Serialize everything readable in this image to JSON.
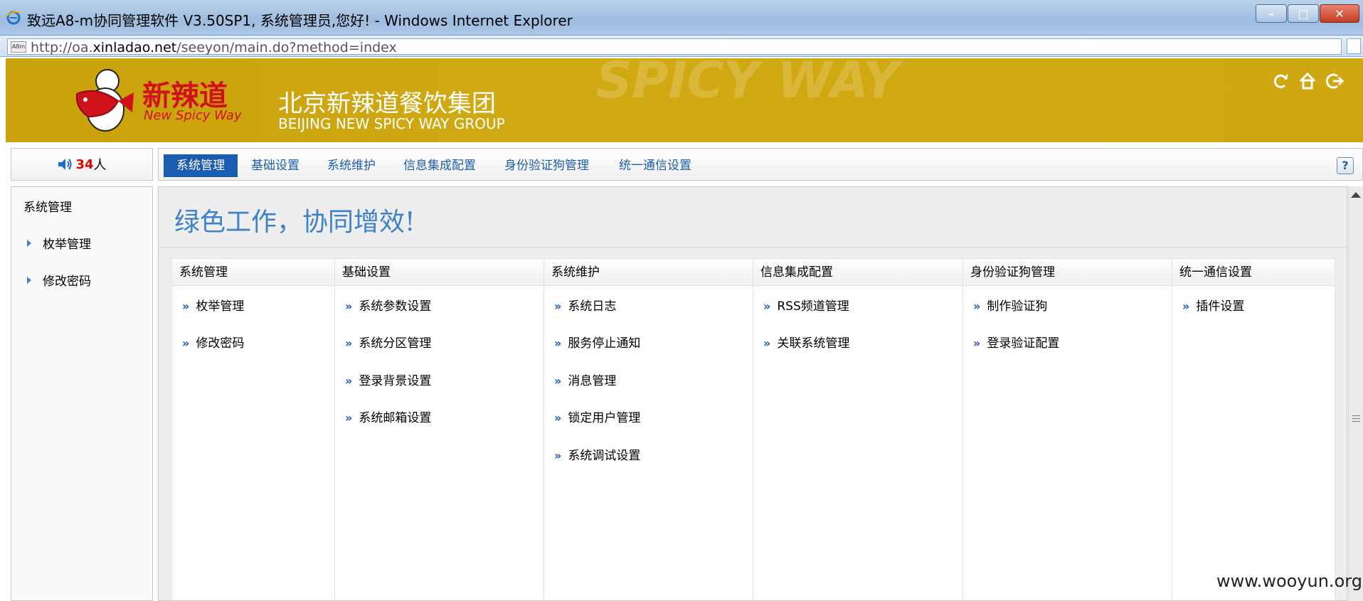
{
  "window": {
    "title": "致远A8-m协同管理软件 V3.50SP1, 系统管理员,您好! - Windows Internet Explorer",
    "min_label": "–",
    "max_label": "□",
    "close_label": "✕"
  },
  "address": {
    "prefix": "http://oa.",
    "domain": "xinladao.net",
    "suffix": "/seeyon/main.do?method=index",
    "favicon_text": "A8m"
  },
  "banner": {
    "logo_cn": "新辣道",
    "logo_en": "New Spicy Way",
    "group_cn": "北京新辣道餐饮集团",
    "group_en": "BEIJING NEW SPICY WAY GROUP",
    "deco_text": "SPICY WAY",
    "icons": [
      "refresh-icon",
      "home-icon",
      "logout-icon"
    ]
  },
  "online": {
    "count": "34",
    "unit": "人"
  },
  "nav": {
    "tabs": [
      "系统管理",
      "基础设置",
      "系统维护",
      "信息集成配置",
      "身份验证狗管理",
      "统一通信设置"
    ],
    "active_index": 0,
    "help": "?"
  },
  "sidebar": {
    "title": "系统管理",
    "items": [
      "枚举管理",
      "修改密码"
    ]
  },
  "main": {
    "slogan": "绿色工作，协同增效!",
    "columns": [
      {
        "title": "系统管理",
        "items": [
          "枚举管理",
          "修改密码"
        ]
      },
      {
        "title": "基础设置",
        "items": [
          "系统参数设置",
          "系统分区管理",
          "登录背景设置",
          "系统邮箱设置"
        ]
      },
      {
        "title": "系统维护",
        "items": [
          "系统日志",
          "服务停止通知",
          "消息管理",
          "锁定用户管理",
          "系统调试设置"
        ]
      },
      {
        "title": "信息集成配置",
        "items": [
          "RSS频道管理",
          "关联系统管理"
        ]
      },
      {
        "title": "身份验证狗管理",
        "items": [
          "制作验证狗",
          "登录验证配置"
        ]
      },
      {
        "title": "统一通信设置",
        "items": [
          "插件设置"
        ]
      }
    ]
  },
  "watermark": "www.wooyun.org",
  "colors": {
    "banner": "#cfa710",
    "nav_active": "#1a5cb0",
    "link_blue": "#1f5ea8",
    "slogan": "#3d82c9",
    "online_count": "#e00000"
  }
}
